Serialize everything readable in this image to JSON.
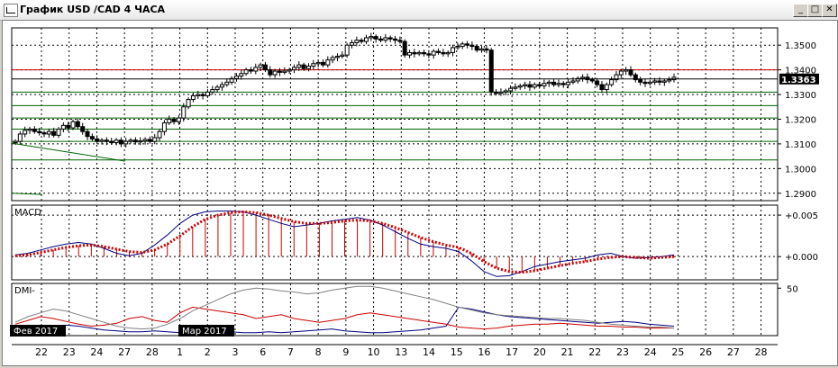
{
  "window": {
    "title": "График USD /CAD  4 ЧАСА",
    "minimize_icon": "minimize-icon",
    "restore_icon": "restore-icon",
    "close_icon": "close-icon"
  },
  "colors": {
    "background": "#ffffff",
    "grid": "#000000",
    "candle": "#000000",
    "resistance_line": "#cc0000",
    "support_lines": "#006400",
    "macd_line": "#000080",
    "macd_signal": "#cc0000",
    "dmi_plus": "#000080",
    "dmi_minus": "#cc0000",
    "adx": "#808080"
  },
  "chart_data": [
    {
      "type": "candlestick",
      "symbol": "USD /CAD",
      "timeframe": "4 ЧАСА",
      "current_price": "1.3363",
      "y_ticks": [
        "1.3500",
        "1.3400",
        "1.3300",
        "1.3200",
        "1.3100",
        "1.3000",
        "1.2900"
      ],
      "ylim": [
        1.287,
        1.357
      ],
      "horizontal_levels": {
        "resistance": [
          1.34
        ],
        "support": [
          1.331,
          1.3255,
          1.3205,
          1.316,
          1.311,
          1.3035
        ]
      },
      "closes": [
        1.311,
        1.314,
        1.3155,
        1.316,
        1.315,
        1.3145,
        1.314,
        1.315,
        1.3135,
        1.316,
        1.3175,
        1.3165,
        1.319,
        1.317,
        1.315,
        1.313,
        1.312,
        1.311,
        1.3115,
        1.311,
        1.3105,
        1.3115,
        1.31,
        1.311,
        1.3115,
        1.3108,
        1.3112,
        1.3118,
        1.311,
        1.3125,
        1.315,
        1.3185,
        1.32,
        1.319,
        1.3205,
        1.325,
        1.328,
        1.3295,
        1.33,
        1.3295,
        1.331,
        1.332,
        1.333,
        1.334,
        1.335,
        1.3365,
        1.3375,
        1.3385,
        1.34,
        1.3395,
        1.341,
        1.342,
        1.34,
        1.338,
        1.3395,
        1.339,
        1.3395,
        1.34,
        1.341,
        1.342,
        1.3405,
        1.3415,
        1.3425,
        1.343,
        1.342,
        1.344,
        1.345,
        1.3455,
        1.346,
        1.35,
        1.351,
        1.352,
        1.3515,
        1.353,
        1.3535,
        1.3525,
        1.352,
        1.353,
        1.3525,
        1.352,
        1.3515,
        1.346,
        1.347,
        1.3465,
        1.347,
        1.3465,
        1.346,
        1.3475,
        1.347,
        1.3465,
        1.347,
        1.349,
        1.3495,
        1.3505,
        1.35,
        1.3495,
        1.348,
        1.3485,
        1.348,
        1.331,
        1.3305,
        1.331,
        1.3315,
        1.3325,
        1.333,
        1.3335,
        1.334,
        1.333,
        1.334,
        1.3335,
        1.3345,
        1.335,
        1.334,
        1.3345,
        1.334,
        1.335,
        1.3355,
        1.3365,
        1.337,
        1.336,
        1.3355,
        1.334,
        1.332,
        1.334,
        1.336,
        1.338,
        1.3395,
        1.34,
        1.338,
        1.336,
        1.335,
        1.3345,
        1.335,
        1.3355,
        1.335,
        1.3355,
        1.336,
        1.337
      ],
      "x_ticks": [
        "22",
        "23",
        "24",
        "27",
        "28",
        "1",
        "2",
        "3",
        "6",
        "7",
        "8",
        "9",
        "10",
        "13",
        "14",
        "15",
        "16",
        "17",
        "20",
        "21",
        "22",
        "23",
        "24",
        "25",
        "26",
        "27",
        "28"
      ],
      "month_labels": [
        "Фев 2017",
        "Мар 2017"
      ]
    },
    {
      "type": "line",
      "title": "MACD",
      "y_ticks": [
        "+0.005",
        "+0.000"
      ],
      "ylim": [
        -0.0028,
        0.0062
      ],
      "series": [
        {
          "values": [
            0.0002,
            0.0004,
            0.0008,
            0.0012,
            0.0015,
            0.0017,
            0.0015,
            0.001,
            0.0004,
            0.0001,
            0.0004,
            0.0014,
            0.0026,
            0.004,
            0.005,
            0.0054,
            0.0055,
            0.0055,
            0.0054,
            0.005,
            0.0045,
            0.004,
            0.0036,
            0.0038,
            0.004,
            0.0043,
            0.0045,
            0.0047,
            0.0044,
            0.0038,
            0.003,
            0.0022,
            0.0015,
            0.0012,
            0.001,
            0.0006,
            -0.0005,
            -0.0018,
            -0.0024,
            -0.0023,
            -0.0018,
            -0.0012,
            -0.0009,
            -0.0006,
            -0.0004,
            -0.0002,
            0.0002,
            0.0004,
            0.0,
            -0.0002,
            -0.0001,
            0.0,
            0.0002
          ]
        },
        {
          "values": [
            0.0001,
            0.0002,
            0.0005,
            0.0008,
            0.0011,
            0.0013,
            0.0014,
            0.0012,
            0.0009,
            0.0006,
            0.0005,
            0.0008,
            0.0015,
            0.0025,
            0.0036,
            0.0045,
            0.005,
            0.0053,
            0.0054,
            0.0053,
            0.005,
            0.0046,
            0.0042,
            0.004,
            0.004,
            0.0041,
            0.0043,
            0.0044,
            0.0043,
            0.004,
            0.0035,
            0.0029,
            0.0023,
            0.0018,
            0.0014,
            0.0011,
            0.0004,
            -0.0006,
            -0.0014,
            -0.0018,
            -0.0019,
            -0.0017,
            -0.0014,
            -0.0011,
            -0.0008,
            -0.0006,
            -0.0003,
            -0.0001,
            0.0,
            -0.0001,
            -0.0002,
            -0.0001,
            0.0
          ]
        }
      ]
    },
    {
      "type": "line",
      "title": "DMI-",
      "y_ticks": [
        "50"
      ],
      "ylim": [
        0,
        55
      ],
      "series": [
        {
          "values": [
            6,
            5,
            7,
            9,
            11,
            10,
            8,
            6,
            5,
            4,
            4,
            5,
            4,
            3,
            3,
            4,
            5,
            4,
            3,
            3,
            4,
            3,
            4,
            5,
            6,
            7,
            5,
            4,
            3,
            3,
            4,
            5,
            6,
            8,
            10,
            30,
            28,
            25,
            22,
            20,
            19,
            18,
            17,
            16,
            15,
            14,
            13,
            14,
            15,
            14,
            12,
            11,
            10
          ]
        },
        {
          "values": [
            12,
            16,
            20,
            18,
            15,
            12,
            10,
            11,
            13,
            18,
            20,
            16,
            14,
            24,
            30,
            28,
            26,
            24,
            22,
            18,
            20,
            22,
            18,
            16,
            14,
            16,
            18,
            22,
            24,
            22,
            20,
            18,
            16,
            14,
            12,
            9,
            8,
            7,
            8,
            10,
            11,
            12,
            12,
            13,
            12,
            11,
            10,
            10,
            9,
            9,
            8,
            8,
            8
          ]
        },
        {
          "values": [
            14,
            20,
            24,
            28,
            26,
            22,
            18,
            14,
            10,
            8,
            7,
            8,
            12,
            18,
            26,
            32,
            38,
            44,
            48,
            50,
            49,
            47,
            46,
            44,
            45,
            48,
            50,
            52,
            52,
            50,
            47,
            44,
            41,
            38,
            34,
            30,
            27,
            24,
            22,
            21,
            20,
            19,
            18,
            18,
            17,
            16,
            14,
            12,
            11,
            10,
            9,
            9,
            8
          ]
        }
      ]
    }
  ]
}
